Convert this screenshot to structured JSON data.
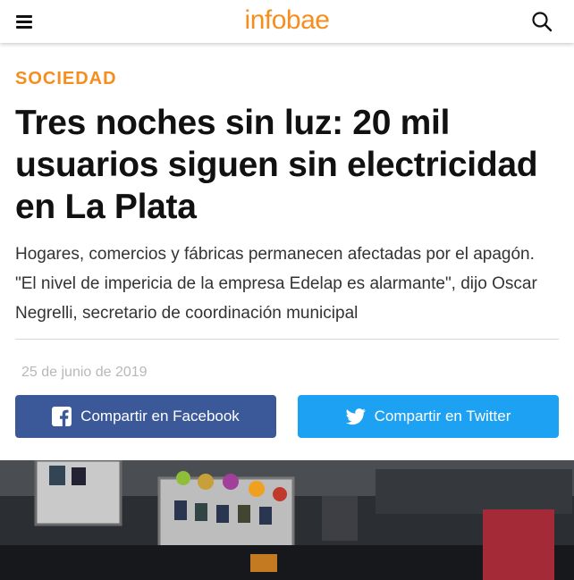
{
  "header": {
    "logo": "infobae",
    "menu_icon": "hamburger-menu-icon",
    "search_icon": "search-icon"
  },
  "article": {
    "section": "SOCIEDAD",
    "headline": "Tres noches sin luz: 20 mil usuarios siguen sin electricidad en La Plata",
    "subtitle": "Hogares, comercios y fábricas permanecen afectadas por el apagón. \"El nivel de impericia de la empresa Edelap es alarmante\", dijo Oscar Negrelli, secretario de coordinación municipal",
    "date": "25 de junio de 2019"
  },
  "share": {
    "facebook_label": "Compartir en Facebook",
    "twitter_label": "Compartir en Twitter",
    "facebook_color": "#3b5998",
    "twitter_color": "#1da1f2"
  },
  "colors": {
    "brand": "#f68e1e"
  }
}
